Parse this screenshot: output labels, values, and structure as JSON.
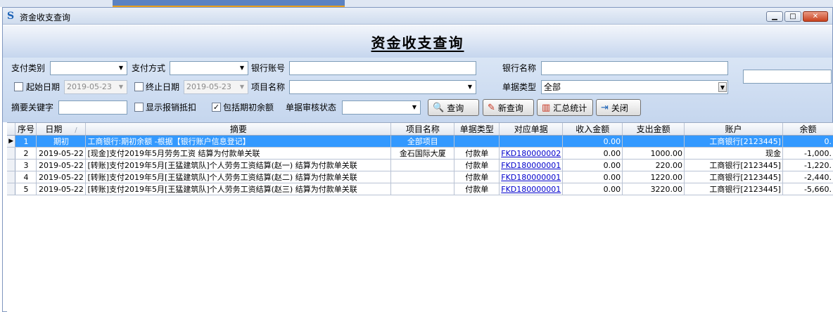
{
  "window": {
    "title": "资金收支查询",
    "header_title": "资金收支查询",
    "minimize": "▁",
    "maximize": "□",
    "close": "✕"
  },
  "filters": {
    "pay_category_label": "支付类别",
    "pay_category_value": "",
    "pay_method_label": "支付方式",
    "pay_method_value": "",
    "bank_account_label": "银行账号",
    "bank_account_value": "",
    "bank_name_label": "银行名称",
    "bank_name_value": "",
    "start_date_label": "起始日期",
    "start_date_value": "2019-05-23",
    "start_date_checked": false,
    "end_date_label": "终止日期",
    "end_date_value": "2019-05-23",
    "end_date_checked": false,
    "project_label": "项目名称",
    "project_value": "",
    "doc_type_label": "单据类型",
    "doc_type_value": "全部",
    "keyword_label": "摘要关键字",
    "keyword_value": "",
    "show_offset_label": "显示报销抵扣",
    "show_offset_checked": false,
    "include_opening_label": "包括期初余额",
    "include_opening_checked": true,
    "audit_status_label": "单据审核状态",
    "audit_status_value": ""
  },
  "buttons": {
    "query": "查询",
    "new_query": "新查询",
    "summary": "汇总统计",
    "close": "关闭"
  },
  "table": {
    "columns": [
      "序号",
      "日期",
      "摘要",
      "项目名称",
      "单据类型",
      "对应单据",
      "收入金额",
      "支出金额",
      "账户",
      "余额"
    ],
    "sort_indicator": "/",
    "rows": [
      {
        "seq": "1",
        "date": "期初",
        "summary": "工商银行:期初余额 -根据【银行账户信息登记】",
        "project": "全部项目",
        "doc_type": "",
        "doc": "",
        "income": "0.00",
        "expense": "",
        "account": "工商银行[2123445]",
        "balance": "0."
      },
      {
        "seq": "2",
        "date": "2019-05-22",
        "summary": "[现金]支付2019年5月劳务工资 结算为付款单关联",
        "project": "金石国际大厦",
        "doc_type": "付款单",
        "doc": "FKD180000002",
        "income": "0.00",
        "expense": "1000.00",
        "account": "现金",
        "balance": "-1,000."
      },
      {
        "seq": "3",
        "date": "2019-05-22",
        "summary": "[转账]支付2019年5月[王猛建筑队]个人劳务工资结算(赵一) 结算为付款单关联",
        "project": "",
        "doc_type": "付款单",
        "doc": "FKD180000001",
        "income": "0.00",
        "expense": "220.00",
        "account": "工商银行[2123445]",
        "balance": "-1,220."
      },
      {
        "seq": "4",
        "date": "2019-05-22",
        "summary": "[转账]支付2019年5月[王猛建筑队]个人劳务工资结算(赵二) 结算为付款单关联",
        "project": "",
        "doc_type": "付款单",
        "doc": "FKD180000001",
        "income": "0.00",
        "expense": "1220.00",
        "account": "工商银行[2123445]",
        "balance": "-2,440."
      },
      {
        "seq": "5",
        "date": "2019-05-22",
        "summary": "[转账]支付2019年5月[王猛建筑队]个人劳务工资结算(赵三) 结算为付款单关联",
        "project": "",
        "doc_type": "付款单",
        "doc": "FKD180000001",
        "income": "0.00",
        "expense": "3220.00",
        "account": "工商银行[2123445]",
        "balance": "-5,660."
      }
    ]
  },
  "colors": {
    "selection": "#3399ff",
    "link": "#0000cc",
    "panel": "#c5d6ee"
  }
}
